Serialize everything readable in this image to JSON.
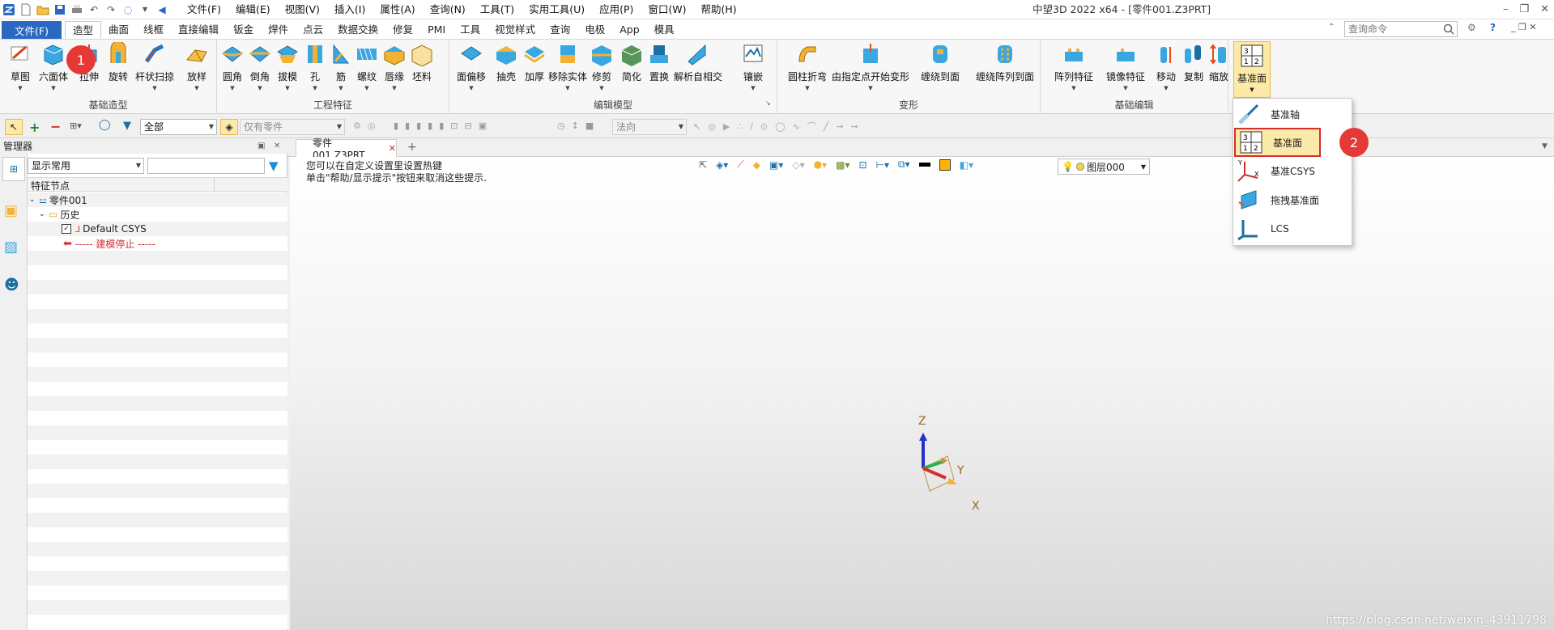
{
  "titlebar": {
    "menus": [
      "文件(F)",
      "编辑(E)",
      "视图(V)",
      "插入(I)",
      "属性(A)",
      "查询(N)",
      "工具(T)",
      "实用工具(U)",
      "应用(P)",
      "窗口(W)",
      "帮助(H)"
    ],
    "title": "中望3D 2022 x64 - [零件001.Z3PRT]"
  },
  "tabs": {
    "file": "文件(F)",
    "items": [
      "造型",
      "曲面",
      "线框",
      "直接编辑",
      "钣金",
      "焊件",
      "点云",
      "数据交换",
      "修复",
      "PMI",
      "工具",
      "视觉样式",
      "查询",
      "电极",
      "App",
      "模具"
    ],
    "active": "造型",
    "search_placeholder": "查询命令"
  },
  "ribbon": {
    "groups": [
      {
        "label": "基础造型",
        "buttons": [
          "草图",
          "六面体",
          "拉伸",
          "旋转",
          "杆状扫掠",
          "放样"
        ]
      },
      {
        "label": "工程特征",
        "buttons": [
          "圆角",
          "倒角",
          "拔模",
          "孔",
          "筋",
          "螺纹",
          "唇缘",
          "坯料"
        ]
      },
      {
        "label": "编辑模型",
        "buttons": [
          "面偏移",
          "抽壳",
          "加厚",
          "移除实体",
          "修剪",
          "简化",
          "置换",
          "解析自相交",
          "镶嵌"
        ]
      },
      {
        "label": "变形",
        "buttons": [
          "圆柱折弯",
          "由指定点开始变形",
          "缠绕到面",
          "缠绕阵列到面"
        ]
      },
      {
        "label": "基础编辑",
        "buttons": [
          "阵列特征",
          "镜像特征",
          "移动",
          "复制",
          "缩放"
        ]
      }
    ],
    "datum_button": "基准面"
  },
  "toolbar": {
    "filter_value": "全部",
    "parts_value": "仅有零件",
    "direction_value": "法向"
  },
  "manager": {
    "title": "管理器",
    "filter_value": "显示常用",
    "column_header": "特征节点",
    "tree": {
      "part": "零件001",
      "history": "历史",
      "csys": "Default CSYS",
      "stop": "----- 建模停止 -----"
    }
  },
  "viewport": {
    "doc_tab": "零件001.Z3PRT",
    "hint_line1": "您可以在自定义设置里设置热键",
    "hint_line2": "单击\"帮助/显示提示\"按钮来取消这些提示.",
    "layer": "图层000",
    "axes": {
      "x": "X",
      "y": "Y",
      "z": "Z"
    }
  },
  "dropdown": {
    "items": [
      "基准轴",
      "基准面",
      "基准CSYS",
      "拖拽基准面",
      "LCS"
    ],
    "highlighted": "基准面"
  },
  "badges": {
    "one": "1",
    "two": "2"
  },
  "watermark": "https://blog.csdn.net/weixin_43911798",
  "colors": {
    "accent": "#2b68c2",
    "badge": "#e53935",
    "highlight": "#fde9a8",
    "stop": "#d32f2f"
  }
}
